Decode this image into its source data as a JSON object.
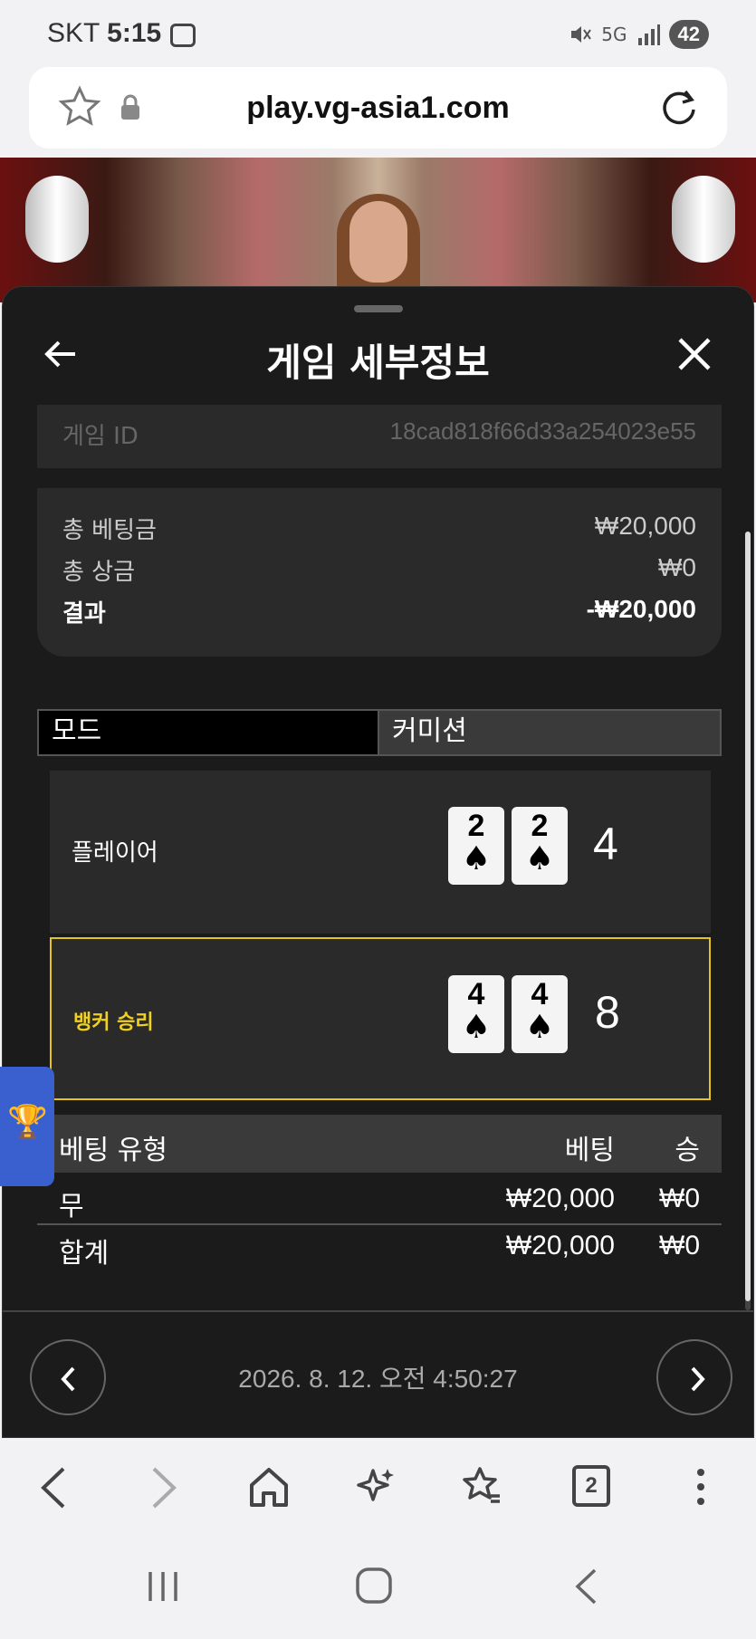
{
  "status_bar": {
    "carrier": "SKT",
    "time": "5:15",
    "network": "5G",
    "battery": "42"
  },
  "browser": {
    "url": "play.vg-asia1.com",
    "tabs_count": "2"
  },
  "sheet": {
    "title": "게임 세부정보",
    "game_id_label": "게임 ID",
    "game_id_value": "18cad818f66d33a254023e55",
    "summary": [
      {
        "label": "총 베팅금",
        "value": "₩20,000"
      },
      {
        "label": "총 상금",
        "value": "₩0"
      },
      {
        "label": "결과",
        "value": "-₩20,000"
      }
    ],
    "mode": {
      "label": "모드",
      "value": "커미션"
    },
    "player": {
      "label": "플레이어",
      "cards": [
        {
          "rank": "2",
          "suit": "♠"
        },
        {
          "rank": "2",
          "suit": "♠"
        }
      ],
      "score": "4"
    },
    "banker": {
      "label": "뱅커 승리",
      "cards": [
        {
          "rank": "4",
          "suit": "♠"
        },
        {
          "rank": "4",
          "suit": "♠"
        }
      ],
      "score": "8",
      "highlight_color": "#e6c419"
    },
    "bets": {
      "headers": {
        "type": "베팅 유형",
        "bet": "베팅",
        "win": "승"
      },
      "rows": [
        {
          "type": "무",
          "bet": "₩20,000",
          "win": "₩0"
        },
        {
          "type": "합계",
          "bet": "₩20,000",
          "win": "₩0"
        }
      ]
    },
    "date": "2026. 8. 12. 오전 4:50:27"
  },
  "colors": {
    "sheet_bg": "#1b1b1b",
    "card_bg": "#2a2a2a",
    "winner_text": "#f0d020",
    "trophy_tab": "#3a5fcf"
  }
}
